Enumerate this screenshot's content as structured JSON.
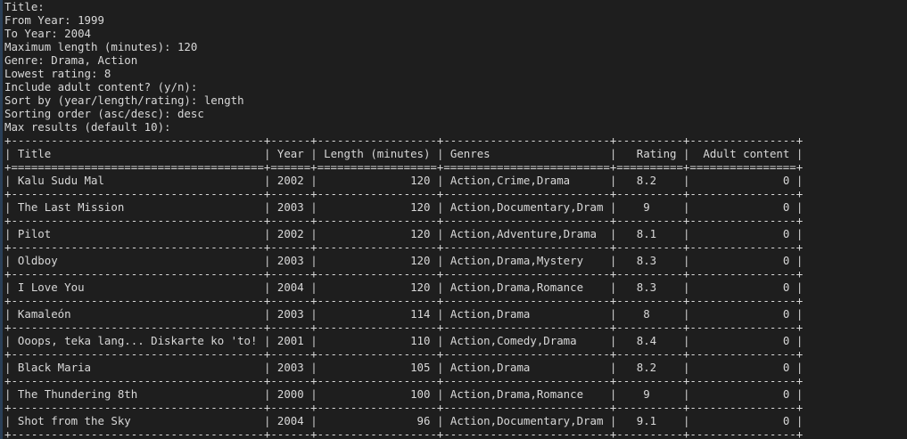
{
  "prompts": [
    {
      "label": "Title:",
      "value": ""
    },
    {
      "label": "From Year:",
      "value": "1999"
    },
    {
      "label": "To Year:",
      "value": "2004"
    },
    {
      "label": "Maximum length (minutes):",
      "value": "120"
    },
    {
      "label": "Genre:",
      "value": "Drama, Action"
    },
    {
      "label": "Lowest rating:",
      "value": "8"
    },
    {
      "label": "Include adult content? (y/n):",
      "value": ""
    },
    {
      "label": "Sort by (year/length/rating):",
      "value": "length"
    },
    {
      "label": "Sorting order (asc/desc):",
      "value": "desc"
    },
    {
      "label": "Max results (default 10):",
      "value": ""
    }
  ],
  "table": {
    "headers": [
      "Title",
      "Year",
      "Length (minutes)",
      "Genres",
      "Rating",
      "Adult content"
    ],
    "rows": [
      [
        "Kalu Sudu Mal",
        "2002",
        "120",
        "Action,Crime,Drama",
        "8.2",
        "0"
      ],
      [
        "The Last Mission",
        "2003",
        "120",
        "Action,Documentary,Drama",
        "9",
        "0"
      ],
      [
        "Pilot",
        "2002",
        "120",
        "Action,Adventure,Drama",
        "8.1",
        "0"
      ],
      [
        "Oldboy",
        "2003",
        "120",
        "Action,Drama,Mystery",
        "8.3",
        "0"
      ],
      [
        "I Love You",
        "2004",
        "120",
        "Action,Drama,Romance",
        "8.3",
        "0"
      ],
      [
        "Kamaleón",
        "2003",
        "114",
        "Action,Drama",
        "8",
        "0"
      ],
      [
        "Ooops, teka lang... Diskarte ko 'to!",
        "2001",
        "110",
        "Action,Comedy,Drama",
        "8.4",
        "0"
      ],
      [
        "Black Maria",
        "2003",
        "105",
        "Action,Drama",
        "8.2",
        "0"
      ],
      [
        "The Thundering 8th",
        "2000",
        "100",
        "Action,Drama,Romance",
        "9",
        "0"
      ],
      [
        "Shot from the Sky",
        "2004",
        "96",
        "Action,Documentary,Drama",
        "9.1",
        "0"
      ]
    ]
  },
  "colors": {
    "background": "#1e1e1e",
    "text": "#d8d8d8",
    "accent_bar": "#2a3f57"
  }
}
